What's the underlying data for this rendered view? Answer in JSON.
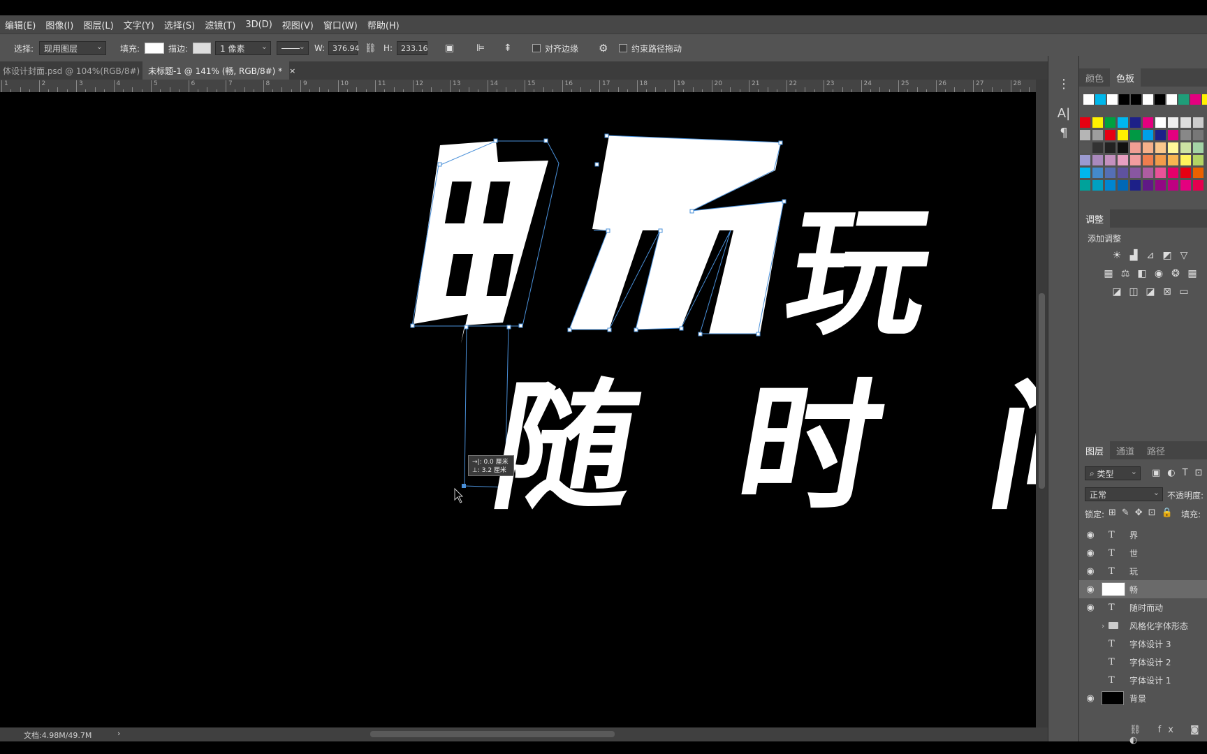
{
  "menu": [
    "编辑(E)",
    "图像(I)",
    "图层(L)",
    "文字(Y)",
    "选择(S)",
    "滤镜(T)",
    "3D(D)",
    "视图(V)",
    "窗口(W)",
    "帮助(H)"
  ],
  "options": {
    "select_label": "选择:",
    "select_value": "现用图层",
    "fill_label": "填充:",
    "stroke_label": "描边:",
    "stroke_width": "1 像素",
    "w_label": "W:",
    "w_value": "376.94",
    "h_label": "H:",
    "h_value": "233.16",
    "align_edges": "对齐边缘",
    "constrain_path": "约束路径拖动"
  },
  "tabs": [
    {
      "label": "体设计封面.psd @ 104%(RGB/8#)",
      "close": "×"
    },
    {
      "label": "未标题-1 @ 141% (畅, RGB/8#) *",
      "close": "×"
    }
  ],
  "ruler_numbers": [
    "1",
    "2",
    "3",
    "4",
    "5",
    "6",
    "7",
    "8",
    "9",
    "10",
    "11",
    "12",
    "13",
    "14",
    "15",
    "16",
    "17",
    "18",
    "19",
    "20",
    "21",
    "22",
    "23",
    "24",
    "25",
    "26",
    "27",
    "28"
  ],
  "canvas": {
    "chars_line1": [
      "畅",
      "玩"
    ],
    "chars_line2": [
      "随",
      "时",
      "间"
    ],
    "tooltip_line1": "→|: 0.0 厘米",
    "tooltip_line2": "⊥: 3.2 厘米"
  },
  "status": {
    "doc": "文档:4.98M/49.7M",
    "arrow": "›"
  },
  "color_panel": {
    "tabs": [
      "颜色",
      "色板"
    ],
    "swatches_row0": [
      "#ffffff",
      "#00b7eb",
      "#ffffff",
      "#000000",
      "#000000",
      "#ffffff",
      "#000000",
      "#ffffff",
      "#1f9e79",
      "#e4007f",
      "#fff100"
    ],
    "swatches_grid": [
      [
        "#e60012",
        "#fff100",
        "#00a040",
        "#00b7ee",
        "#1d2088",
        "#e4007f",
        "#ffffff",
        "#eeeeee",
        "#dddddd",
        "#cccccc"
      ],
      [
        "#b5b5b5",
        "#9e9e9e",
        "#e60012",
        "#fff100",
        "#009944",
        "#00a0e9",
        "#1d2088",
        "#e4007f",
        "#888888",
        "#777777"
      ],
      [
        "#555555",
        "#333333",
        "#222222",
        "#111111",
        "#f19e94",
        "#f5b08a",
        "#fac88c",
        "#fff799",
        "#cde3a3",
        "#a4d3a5"
      ],
      [
        "#9b9ad0",
        "#aa89bd",
        "#c490bf",
        "#e89fc2",
        "#f29c9f",
        "#ee7d4e",
        "#f29b4a",
        "#f8b551",
        "#fff45c",
        "#b3d465"
      ],
      [
        "#00b7ee",
        "#448aca",
        "#556fb5",
        "#5f52a0",
        "#8957a1",
        "#ae5da1",
        "#e85298",
        "#e5006a",
        "#e60012",
        "#eb6100"
      ],
      [
        "#00a29a",
        "#00a0c1",
        "#0086d1",
        "#0068b7",
        "#1d2088",
        "#601986",
        "#920783",
        "#be0081",
        "#e4007f",
        "#e5004f"
      ]
    ]
  },
  "adjust_panel": {
    "title": "调整",
    "add": "添加调整"
  },
  "layers_panel": {
    "tabs": [
      "图层",
      "通道",
      "路径"
    ],
    "kind": "类型",
    "blend": "正常",
    "opacity_label": "不透明度:",
    "lock_label": "锁定:",
    "fill_label": "填充:",
    "layers": [
      {
        "name": "界",
        "kind": "text",
        "visible": true
      },
      {
        "name": "世",
        "kind": "text",
        "visible": true
      },
      {
        "name": "玩",
        "kind": "text",
        "visible": true
      },
      {
        "name": "畅",
        "kind": "shape",
        "visible": true,
        "selected": true
      },
      {
        "name": "随时而动",
        "kind": "text",
        "visible": true
      },
      {
        "name": "风格化字体形态",
        "kind": "group",
        "visible": false
      },
      {
        "name": "字体设计 3",
        "kind": "text",
        "visible": false
      },
      {
        "name": "字体设计 2",
        "kind": "text",
        "visible": false
      },
      {
        "name": "字体设计 1",
        "kind": "text",
        "visible": false
      },
      {
        "name": "背景",
        "kind": "bg",
        "visible": true
      }
    ]
  }
}
